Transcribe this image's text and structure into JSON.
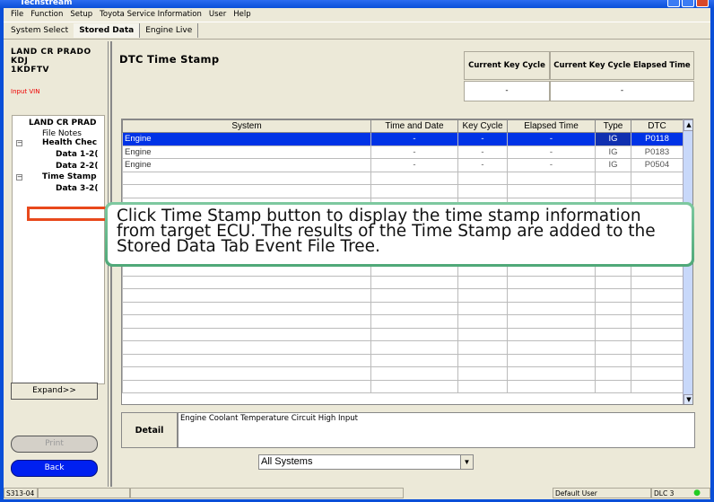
{
  "window": {
    "title": "Techstream"
  },
  "menu": [
    "File",
    "Function",
    "Setup",
    "Toyota Service Information",
    "User",
    "Help"
  ],
  "tabs": [
    {
      "label": "System Select"
    },
    {
      "label": "Stored Data"
    },
    {
      "label": "Engine Live"
    }
  ],
  "vehicle": {
    "line1": "LAND CR PRADO",
    "line2": "KDJ",
    "line3": "1KDFTV",
    "vin_link": "Input VIN"
  },
  "tree": [
    "LAND CR PRAD",
    "File Notes",
    "Health Chec",
    "Data 1-2(",
    "Data 2-2(",
    "Time Stamp",
    "Data 3-2("
  ],
  "left_buttons": {
    "expand": "Expand>>",
    "print": "Print",
    "back": "Back"
  },
  "main": {
    "title": "DTC Time Stamp",
    "key_cycle": {
      "header1": "Current Key Cycle",
      "header2": "Current Key Cycle Elapsed Time",
      "value1": "-",
      "value2": "-"
    },
    "table": {
      "columns": [
        "System",
        "Time and Date",
        "Key Cycle",
        "Elapsed Time",
        "Type",
        "DTC"
      ],
      "rows": [
        [
          "Engine",
          "-",
          "-",
          "-",
          "IG",
          "P0118"
        ],
        [
          "Engine",
          "-",
          "-",
          "-",
          "IG",
          "P0183"
        ],
        [
          "Engine",
          "-",
          "-",
          "-",
          "IG",
          "P0504"
        ]
      ]
    },
    "detail_label": "Detail",
    "detail_value": "Engine Coolant Temperature Circuit High Input",
    "filter": "All Systems"
  },
  "callout": "Click Time Stamp button to display the time stamp information from target ECU. The results of the Time Stamp are added to the Stored Data Tab Event File Tree.",
  "status": {
    "code": "S313-04",
    "user": "Default User",
    "dlc": "DLC 3",
    "indicator_color": "#22cc22"
  }
}
